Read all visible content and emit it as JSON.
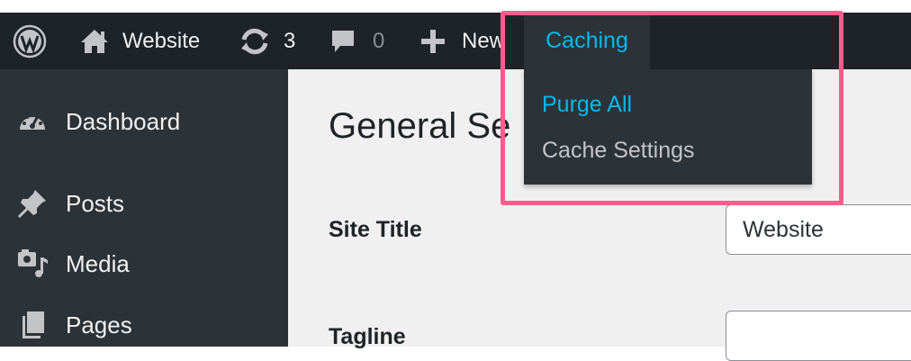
{
  "adminbar": {
    "site_name": "Website",
    "updates_count": "3",
    "comments_count": "0",
    "new_label": "New",
    "caching_label": "Caching"
  },
  "caching_menu": {
    "items": [
      {
        "label": "Purge All",
        "color": "#00b9eb"
      },
      {
        "label": "Cache Settings",
        "color": "#c3c4c7"
      }
    ]
  },
  "sidebar": {
    "items": [
      {
        "label": "Dashboard",
        "icon": "dashboard-icon"
      },
      {
        "label": "Posts",
        "icon": "pushpin-icon"
      },
      {
        "label": "Media",
        "icon": "media-icon"
      },
      {
        "label": "Pages",
        "icon": "pages-icon"
      }
    ]
  },
  "main": {
    "title": "General Se",
    "fields": [
      {
        "label": "Site Title",
        "value": "Website"
      },
      {
        "label": "Tagline",
        "value": ""
      }
    ]
  },
  "colors": {
    "adminbar_bg": "#1d2327",
    "sidebar_bg": "#2c3338",
    "accent": "#00b9eb",
    "highlight": "#ff5c8d"
  }
}
